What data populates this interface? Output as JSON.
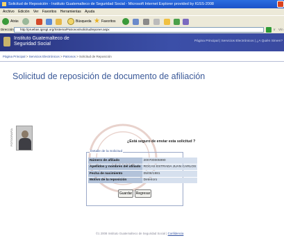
{
  "window": {
    "title": "Solicitud de Reposición - Instituto Guatemalteco de Seguridad Social - Microsoft Internet Explorer provided by IGSS-2008"
  },
  "menu": [
    "Archivo",
    "Edición",
    "Ver",
    "Favoritos",
    "Herramientas",
    "Ayuda"
  ],
  "toolbar": {
    "back_label": "Atrás",
    "search_label": "Búsqueda",
    "favorites_label": "Favoritos"
  },
  "address": {
    "label": "Dirección",
    "url": "http://pruebas.igssgt.org/Sistema/Patronos/solicitudreponer.aspx",
    "go_label": "Ir",
    "links_label": "Vín"
  },
  "header": {
    "institution_line1": "Instituto Guatemalteco de",
    "institution_line2": "Seguridad Social",
    "right_text": "Página Principal | Servicios Electrónicos | ¿A Quién Sirven?"
  },
  "breadcrumb": {
    "items": [
      "Página Principal",
      "Servicios Electrónicos",
      "Patronos",
      "Solicitud de Reposición"
    ]
  },
  "page": {
    "title": "Solicitud de reposición de documento de afiliación",
    "question": "¿Está seguro de enviar esta solicitud ?",
    "photo_label": "FOTOGRAFÍA"
  },
  "details": {
    "legend": "Detalle de la Solicitud",
    "rows": [
      {
        "label": "Número de afiliado",
        "value": "200700005990"
      },
      {
        "label": "Apellidos y nombres del afiliado",
        "value": "ROCAS ESTRADA JUAN CARLOS"
      },
      {
        "label": "Fecha de nacimiento",
        "value": "05/08/1981"
      },
      {
        "label": "Motivo de la reposición",
        "value": "Deterioro"
      }
    ]
  },
  "buttons": {
    "save_label": "Guardar",
    "back_label": "Regresar"
  },
  "footer": {
    "copyright": "©1 2008 Instituto Guatemalteco de Seguridad Social | ",
    "link": "Confidencia"
  },
  "colors": {
    "header_bg": "#2a3580",
    "title_accent": "#3b5998",
    "label_cell": "#b3c3da",
    "value_cell": "#d6e0ee"
  }
}
